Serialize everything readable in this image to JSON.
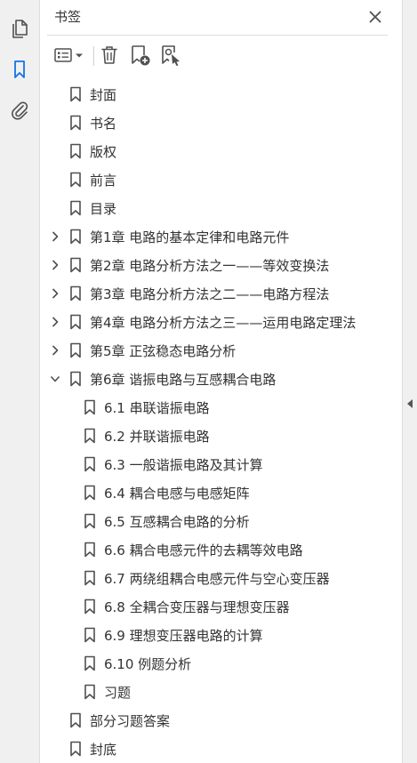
{
  "panel": {
    "title": "书签",
    "close_icon": "close-icon"
  },
  "rail": {
    "items": [
      {
        "name": "page-thumbnails",
        "icon": "pages-icon",
        "active": false
      },
      {
        "name": "bookmarks",
        "icon": "bookmark-icon",
        "active": true
      },
      {
        "name": "attachments",
        "icon": "paperclip-icon",
        "active": false
      }
    ]
  },
  "toolbar": {
    "buttons": [
      {
        "name": "options-menu",
        "icon": "list-options-icon"
      },
      {
        "name": "delete-bookmark",
        "icon": "trash-icon"
      },
      {
        "name": "new-bookmark",
        "icon": "bookmark-add-icon"
      },
      {
        "name": "find-current-bookmark",
        "icon": "bookmark-find-icon"
      }
    ]
  },
  "colors": {
    "accent": "#1473e6",
    "icon": "#505050",
    "text": "#333333"
  },
  "bookmarks": [
    {
      "label": "封面",
      "level": 0,
      "expander": "none"
    },
    {
      "label": "书名",
      "level": 0,
      "expander": "none"
    },
    {
      "label": "版权",
      "level": 0,
      "expander": "none"
    },
    {
      "label": "前言",
      "level": 0,
      "expander": "none"
    },
    {
      "label": "目录",
      "level": 0,
      "expander": "none"
    },
    {
      "label": "第1章 电路的基本定律和电路元件",
      "level": 0,
      "expander": "collapsed"
    },
    {
      "label": "第2章 电路分析方法之一——等效变换法",
      "level": 0,
      "expander": "collapsed"
    },
    {
      "label": "第3章 电路分析方法之二——电路方程法",
      "level": 0,
      "expander": "collapsed"
    },
    {
      "label": "第4章 电路分析方法之三——运用电路定理法",
      "level": 0,
      "expander": "collapsed"
    },
    {
      "label": "第5章 正弦稳态电路分析",
      "level": 0,
      "expander": "collapsed"
    },
    {
      "label": "第6章 谐振电路与互感耦合电路",
      "level": 0,
      "expander": "expanded"
    },
    {
      "label": "6.1 串联谐振电路",
      "level": 1,
      "expander": "none"
    },
    {
      "label": "6.2 并联谐振电路",
      "level": 1,
      "expander": "none"
    },
    {
      "label": "6.3 一般谐振电路及其计算",
      "level": 1,
      "expander": "none"
    },
    {
      "label": "6.4 耦合电感与电感矩阵",
      "level": 1,
      "expander": "none"
    },
    {
      "label": "6.5 互感耦合电路的分析",
      "level": 1,
      "expander": "none"
    },
    {
      "label": "6.6 耦合电感元件的去耦等效电路",
      "level": 1,
      "expander": "none"
    },
    {
      "label": "6.7 两绕组耦合电感元件与空心变压器",
      "level": 1,
      "expander": "none"
    },
    {
      "label": "6.8 全耦合变压器与理想变压器",
      "level": 1,
      "expander": "none"
    },
    {
      "label": "6.9 理想变压器电路的计算",
      "level": 1,
      "expander": "none"
    },
    {
      "label": "6.10 例题分析",
      "level": 1,
      "expander": "none"
    },
    {
      "label": "习题",
      "level": 1,
      "expander": "none"
    },
    {
      "label": "部分习题答案",
      "level": 0,
      "expander": "none"
    },
    {
      "label": "封底",
      "level": 0,
      "expander": "none"
    }
  ]
}
